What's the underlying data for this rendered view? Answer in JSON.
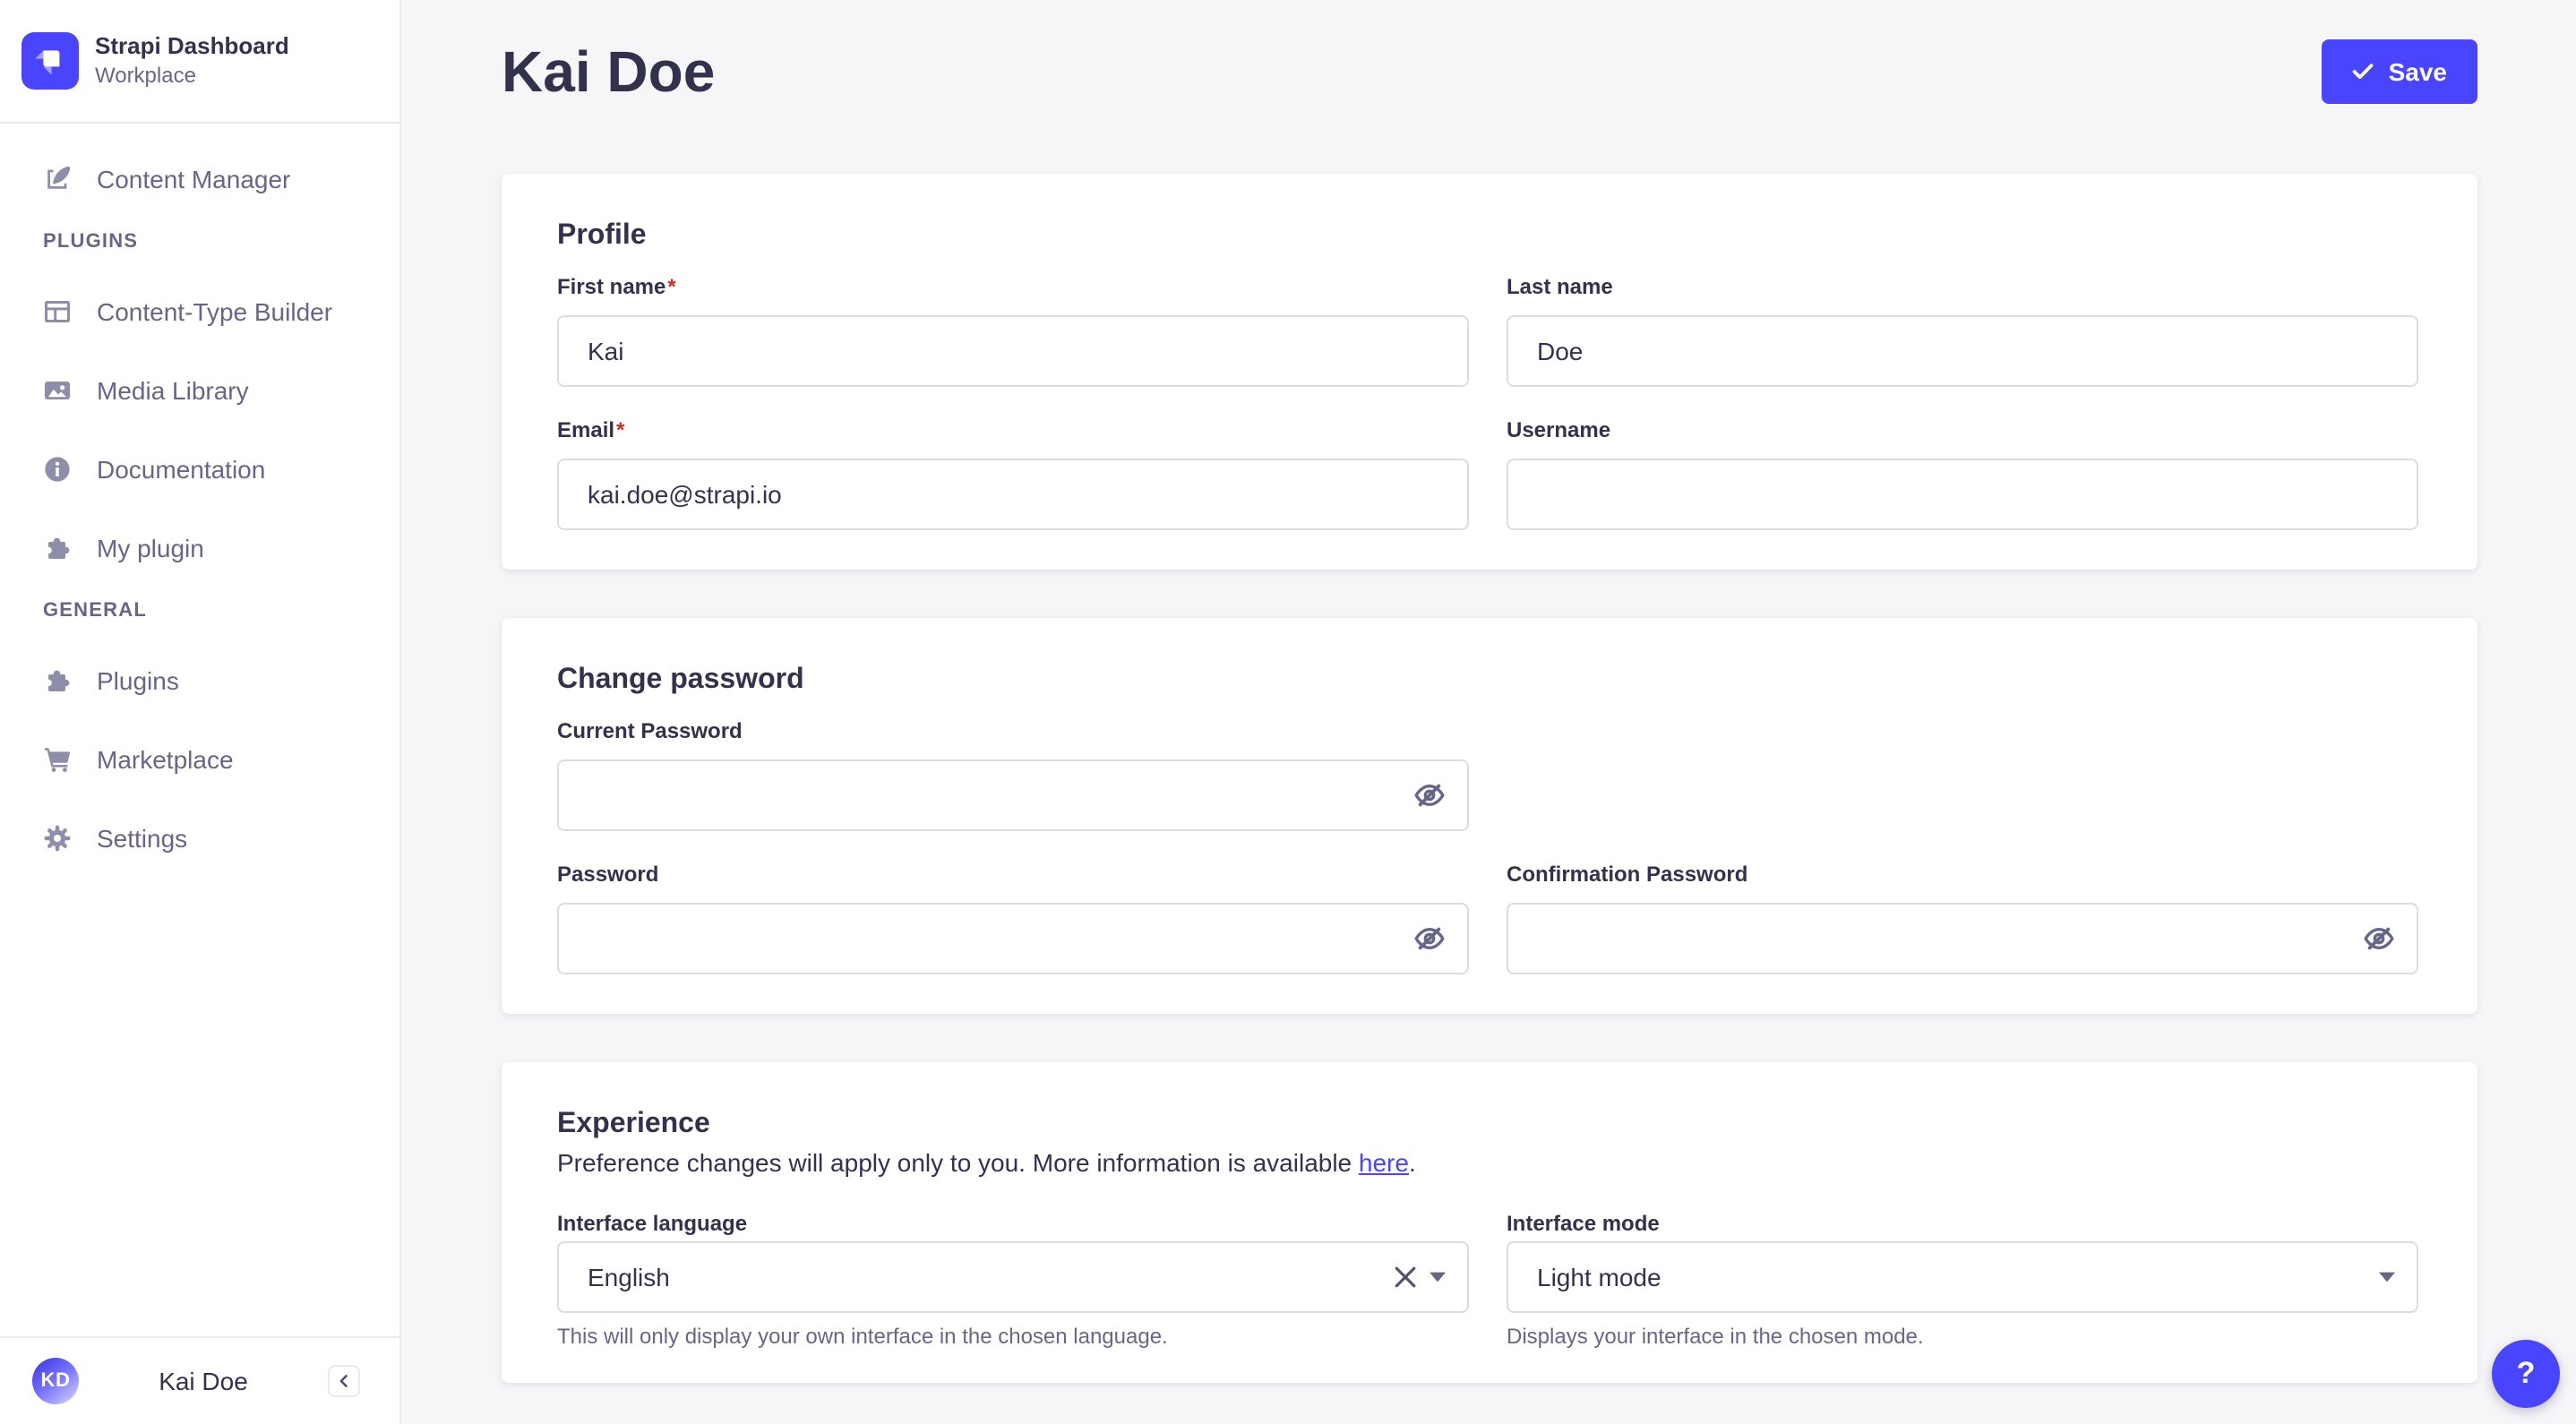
{
  "ui": {
    "required_marker": "*"
  },
  "sidebar": {
    "brand": {
      "title": "Strapi Dashboard",
      "subtitle": "Workplace"
    },
    "content_manager": {
      "label": "Content Manager"
    },
    "sections": [
      {
        "label": "PLUGINS",
        "items": [
          {
            "label": "Content-Type Builder",
            "icon": "layout-icon"
          },
          {
            "label": "Media Library",
            "icon": "image-icon"
          },
          {
            "label": "Documentation",
            "icon": "info-icon"
          },
          {
            "label": "My plugin",
            "icon": "puzzle-icon"
          }
        ]
      },
      {
        "label": "GENERAL",
        "items": [
          {
            "label": "Plugins",
            "icon": "puzzle-icon"
          },
          {
            "label": "Marketplace",
            "icon": "cart-icon"
          },
          {
            "label": "Settings",
            "icon": "gear-icon"
          }
        ]
      }
    ],
    "footer": {
      "initials": "KD",
      "name": "Kai Doe"
    }
  },
  "header": {
    "title": "Kai Doe",
    "save_label": "Save"
  },
  "profile": {
    "title": "Profile",
    "first_name": {
      "label": "First name",
      "value": "Kai"
    },
    "last_name": {
      "label": "Last name",
      "value": "Doe"
    },
    "email": {
      "label": "Email",
      "value": "kai.doe@strapi.io"
    },
    "username": {
      "label": "Username",
      "value": ""
    }
  },
  "password": {
    "title": "Change password",
    "current": {
      "label": "Current Password",
      "value": ""
    },
    "new": {
      "label": "Password",
      "value": ""
    },
    "confirm": {
      "label": "Confirmation Password",
      "value": ""
    }
  },
  "experience": {
    "title": "Experience",
    "description": "Preference changes will apply only to you. More information is available ",
    "link_label": "here",
    "description_end": ".",
    "language": {
      "label": "Interface language",
      "value": "English",
      "hint": "This will only display your own interface in the chosen language."
    },
    "mode": {
      "label": "Interface mode",
      "value": "Light mode",
      "hint": "Displays your interface in the chosen mode."
    }
  },
  "help": {
    "label": "?"
  },
  "colors": {
    "accent": "#4945ff",
    "danger": "#d02b20",
    "text": "#32324d",
    "muted": "#666687",
    "border": "#dcdce4",
    "divider": "#eaeaef",
    "bg": "#f6f6f9"
  }
}
